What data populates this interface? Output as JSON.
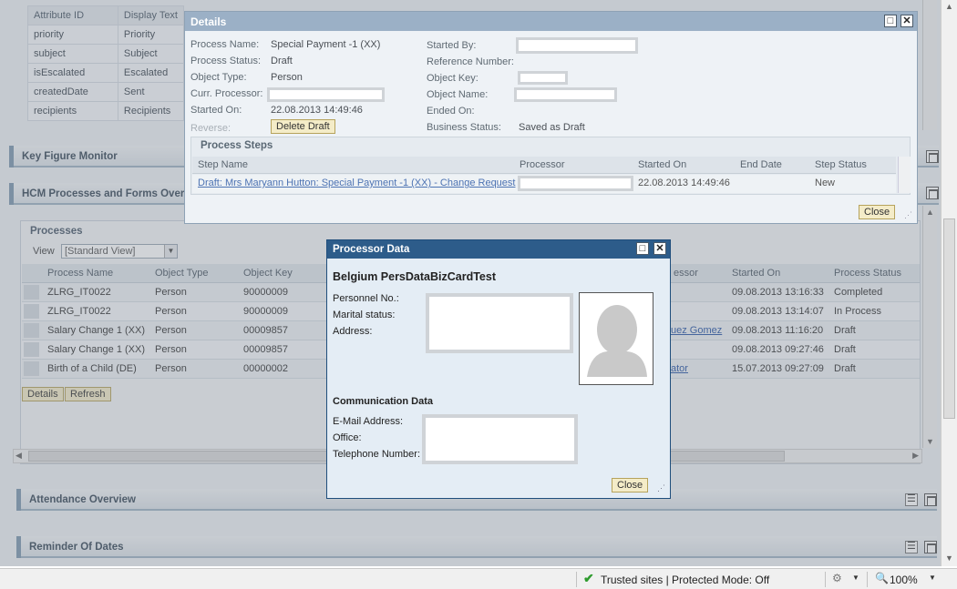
{
  "attr_table": {
    "headers": [
      "Attribute ID",
      "Display Text"
    ],
    "rows": [
      [
        "priority",
        "Priority"
      ],
      [
        "subject",
        "Subject"
      ],
      [
        "isEscalated",
        "Escalated"
      ],
      [
        "createdDate",
        "Sent"
      ],
      [
        "recipients",
        "Recipients"
      ]
    ]
  },
  "panels": {
    "key_figure": "Key Figure Monitor",
    "hcm": "HCM Processes and Forms Overv",
    "attendance": "Attendance Overview",
    "reminder": "Reminder Of Dates"
  },
  "processes": {
    "title": "Processes",
    "view_label": "View",
    "view_value": "[Standard View]",
    "columns": [
      "Process Name",
      "Object Type",
      "Object Key",
      "essor",
      "Started On",
      "Process Status"
    ],
    "rows": [
      {
        "name": "ZLRG_IT0022",
        "type": "Person",
        "key": "90000009",
        "proc": "",
        "started": "09.08.2013 13:16:33",
        "status": "Completed"
      },
      {
        "name": "ZLRG_IT0022",
        "type": "Person",
        "key": "90000009",
        "proc": "",
        "started": "09.08.2013 13:14:07",
        "status": "In Process"
      },
      {
        "name": "Salary Change 1 (XX)",
        "type": "Person",
        "key": "00009857",
        "proc": "uez Gomez",
        "started": "09.08.2013 11:16:20",
        "status": "Draft"
      },
      {
        "name": "Salary Change 1 (XX)",
        "type": "Person",
        "key": "00009857",
        "proc": "",
        "started": "09.08.2013 09:27:46",
        "status": "Draft"
      },
      {
        "name": "Birth of a Child (DE)",
        "type": "Person",
        "key": "00000002",
        "proc": "ator",
        "started": "15.07.2013 09:27:09",
        "status": "Draft"
      }
    ],
    "details_btn": "Details",
    "refresh_btn": "Refresh"
  },
  "details": {
    "title": "Details",
    "labels": {
      "process_name": "Process Name:",
      "process_status": "Process Status:",
      "object_type": "Object Type:",
      "curr_processor": "Curr. Processor:",
      "started_on": "Started On:",
      "reverse": "Reverse:",
      "started_by": "Started By:",
      "reference_number": "Reference Number:",
      "object_key": "Object Key:",
      "object_name": "Object Name:",
      "ended_on": "Ended On:",
      "business_status": "Business Status:"
    },
    "values": {
      "process_name": "Special Payment -1 (XX)",
      "process_status": "Draft",
      "object_type": "Person",
      "started_on": "22.08.2013 14:49:46",
      "business_status": "Saved as Draft"
    },
    "delete_draft_btn": "Delete Draft",
    "steps_title": "Process Steps",
    "steps_columns": [
      "Step Name",
      "Processor",
      "Started On",
      "End Date",
      "Step Status"
    ],
    "step": {
      "name": "Draft: Mrs Maryann Hutton: Special Payment -1 (XX) - Change Request",
      "started": "22.08.2013 14:49:46",
      "end": "",
      "status": "New"
    },
    "close_btn": "Close"
  },
  "processor": {
    "title": "Processor Data",
    "name": "Belgium PersDataBizCardTest",
    "personnel_no": "Personnel No.:",
    "marital_status": "Marital status:",
    "address": "Address:",
    "comm_title": "Communication Data",
    "email": "E-Mail Address:",
    "office": "Office:",
    "telephone": "Telephone Number:",
    "close_btn": "Close"
  },
  "statusbar": {
    "trusted": "Trusted sites | Protected Mode: Off",
    "zoom": "100%"
  },
  "colors": {
    "title_blue": "#2d5c8a",
    "button_bg": "#f4ecc8",
    "trusted_check": "#2e9b2e"
  }
}
